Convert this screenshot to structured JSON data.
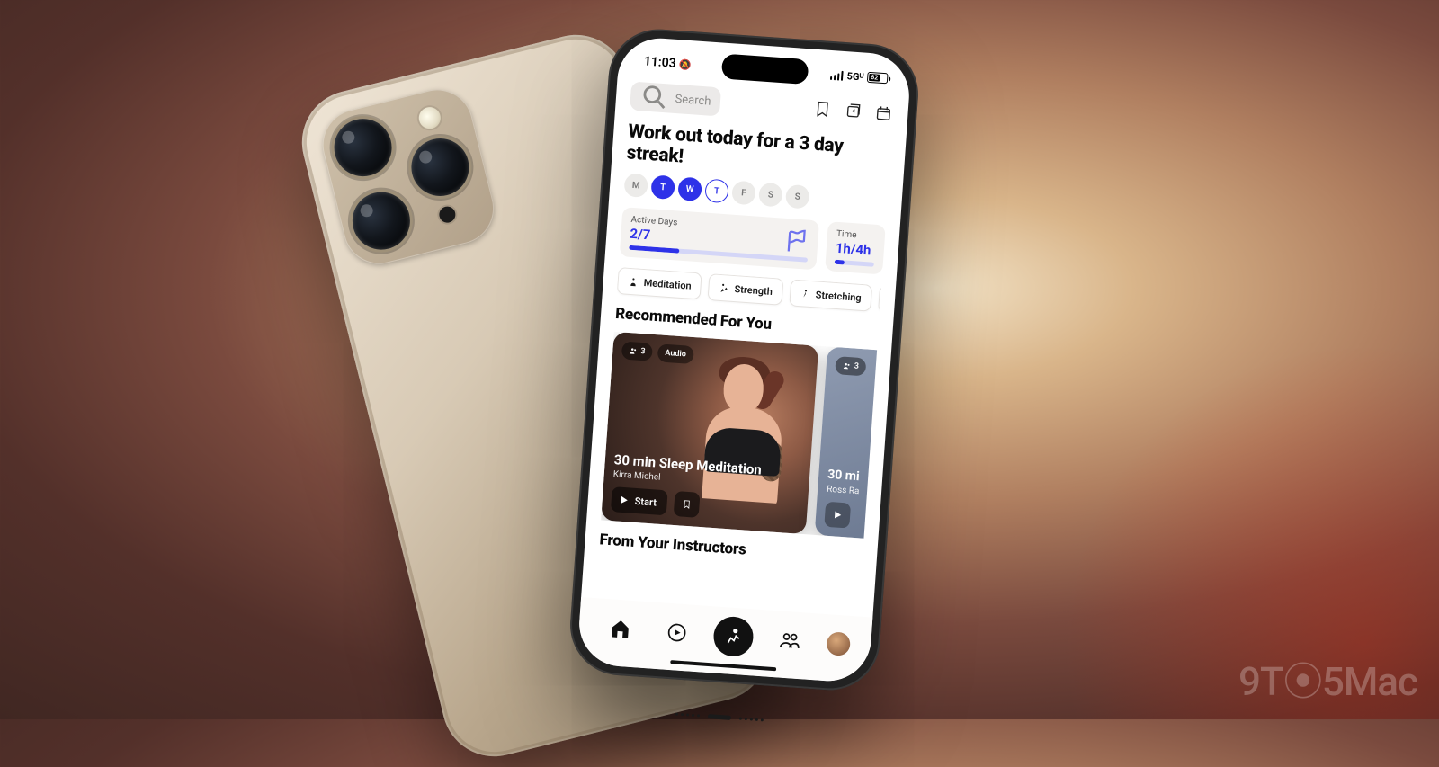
{
  "watermark": "9T⦿5Mac",
  "status": {
    "time": "11:03",
    "signal_label": "5Gᵁ",
    "battery_pct": "62"
  },
  "search": {
    "placeholder": "Search"
  },
  "heading": "Work out today for a 3 day streak!",
  "days": [
    {
      "label": "M",
      "state": "idle"
    },
    {
      "label": "T",
      "state": "active"
    },
    {
      "label": "W",
      "state": "active"
    },
    {
      "label": "T",
      "state": "outline"
    },
    {
      "label": "F",
      "state": "idle"
    },
    {
      "label": "S",
      "state": "idle"
    },
    {
      "label": "S",
      "state": "idle"
    }
  ],
  "stats": {
    "active_days": {
      "label": "Active Days",
      "value": "2/7",
      "progress": 0.28
    },
    "time": {
      "label": "Time",
      "value": "1h/4h",
      "progress": 0.25
    }
  },
  "categories": [
    {
      "icon": "meditation-icon",
      "label": "Meditation"
    },
    {
      "icon": "strength-icon",
      "label": "Strength"
    },
    {
      "icon": "stretching-icon",
      "label": "Stretching"
    }
  ],
  "sections": {
    "recommended": "Recommended For You",
    "instructors": "From Your Instructors"
  },
  "cards": {
    "c1": {
      "people": "3",
      "tag": "Audio",
      "title": "30 min Sleep Meditation",
      "instructor": "Kirra Michel",
      "start": "Start"
    },
    "c2": {
      "people": "3",
      "title_part": "30 mi",
      "instructor_part": "Ross Ra"
    }
  },
  "tabbar": {
    "items": [
      "home",
      "video",
      "run",
      "community",
      "profile"
    ]
  }
}
